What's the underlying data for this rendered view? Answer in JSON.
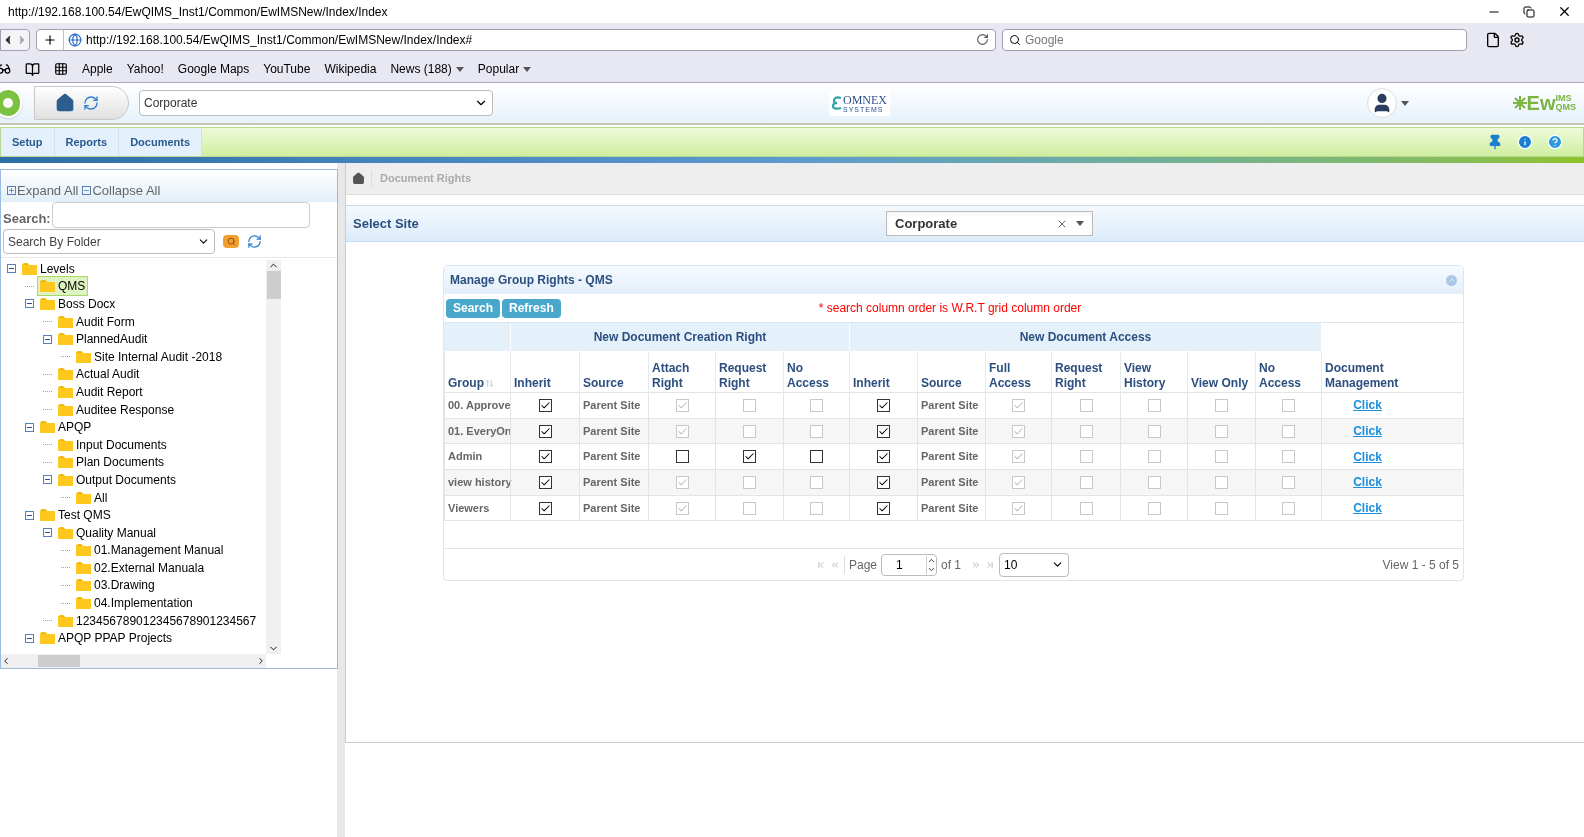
{
  "window": {
    "title": "http://192.168.100.54/EwQIMS_Inst1/Common/EwIMSNew/Index/Index"
  },
  "browser": {
    "address": "http://192.168.100.54/EwQIMS_Inst1/Common/EwIMSNew/Index/Index#",
    "search_placeholder": "Google",
    "bookmarks": [
      {
        "label": "Apple",
        "menu": false
      },
      {
        "label": "Yahoo!",
        "menu": false
      },
      {
        "label": "Google Maps",
        "menu": false
      },
      {
        "label": "YouTube",
        "menu": false
      },
      {
        "label": "Wikipedia",
        "menu": false
      },
      {
        "label": "News (188)",
        "menu": true
      },
      {
        "label": "Popular",
        "menu": true
      }
    ]
  },
  "header": {
    "site_select": "Corporate",
    "logo_text": "OMNEX",
    "logo_subtext": "SYSTEMS",
    "brand": "Ew",
    "brand_sup": "IMS",
    "brand_sub": "QMS"
  },
  "nav_tabs": [
    {
      "label": "Setup",
      "selected": false
    },
    {
      "label": "Reports",
      "selected": false
    },
    {
      "label": "Documents",
      "selected": false
    }
  ],
  "sidebar": {
    "expand_all": "Expand All",
    "collapse_all": "Collapse All",
    "search_label": "Search:",
    "search_by": "Search By Folder",
    "tree": [
      {
        "label": "Levels",
        "expanded": true,
        "selected": false,
        "children": [
          {
            "label": "QMS",
            "selected": true
          },
          {
            "label": "Boss Docx",
            "expanded": true,
            "selected": false,
            "children": [
              {
                "label": "Audit Form",
                "selected": false
              },
              {
                "label": "PlannedAudit",
                "expanded": true,
                "selected": false,
                "children": [
                  {
                    "label": "Site Internal Audit -2018",
                    "selected": false
                  }
                ]
              },
              {
                "label": "Actual Audit",
                "selected": false
              },
              {
                "label": "Audit Report",
                "selected": false
              },
              {
                "label": "Auditee Response",
                "selected": false
              }
            ]
          },
          {
            "label": "APQP",
            "expanded": true,
            "selected": false,
            "children": [
              {
                "label": "Input Documents",
                "selected": false
              },
              {
                "label": "Plan Documents",
                "selected": false
              },
              {
                "label": "Output Documents",
                "expanded": true,
                "selected": false,
                "children": [
                  {
                    "label": "All",
                    "selected": false
                  }
                ]
              }
            ]
          },
          {
            "label": "Test QMS",
            "expanded": true,
            "selected": false,
            "children": [
              {
                "label": "Quality Manual",
                "expanded": true,
                "selected": false,
                "children": [
                  {
                    "label": "01.Management Manual",
                    "selected": false
                  },
                  {
                    "label": "02.External Manuala",
                    "selected": false
                  },
                  {
                    "label": "03.Drawing",
                    "selected": false
                  },
                  {
                    "label": "04.Implementation",
                    "selected": false
                  }
                ]
              },
              {
                "label": "123456789012345678901234567",
                "selected": false
              }
            ]
          },
          {
            "label": "APQP PPAP Projects",
            "expanded": true,
            "selected": false
          }
        ]
      }
    ]
  },
  "breadcrumb": [
    "Document Rights"
  ],
  "site": {
    "label": "Select Site",
    "value": "Corporate"
  },
  "grid": {
    "title": "Manage Group Rights - QMS",
    "buttons": [
      "Search",
      "Refresh"
    ],
    "note": "* search column order is W.R.T grid column order",
    "groups": [
      {
        "label": "New Document Creation Right"
      },
      {
        "label": "New Document Access"
      }
    ],
    "columns": [
      "Group",
      "Inherit",
      "Source",
      "Attach Right",
      "Request Right",
      "No Access",
      "Inherit",
      "Source",
      "Full Access",
      "Request Right",
      "View History",
      "View Only",
      "No Access",
      "Document Management"
    ],
    "rows": [
      {
        "cells": [
          {
            "kind": "text",
            "text": "00. Approve"
          },
          {
            "kind": "check",
            "checked": true,
            "disabled": false
          },
          {
            "kind": "text",
            "text": "Parent Site"
          },
          {
            "kind": "check",
            "checked": true,
            "disabled": true
          },
          {
            "kind": "check",
            "checked": false,
            "disabled": true
          },
          {
            "kind": "check",
            "checked": false,
            "disabled": true
          },
          {
            "kind": "check",
            "checked": true,
            "disabled": false
          },
          {
            "kind": "text",
            "text": "Parent Site"
          },
          {
            "kind": "check",
            "checked": true,
            "disabled": true
          },
          {
            "kind": "check",
            "checked": false,
            "disabled": true
          },
          {
            "kind": "check",
            "checked": false,
            "disabled": true
          },
          {
            "kind": "check",
            "checked": false,
            "disabled": true
          },
          {
            "kind": "check",
            "checked": false,
            "disabled": true
          },
          {
            "kind": "link",
            "text": "Click"
          }
        ]
      },
      {
        "cells": [
          {
            "kind": "text",
            "text": "01. EveryOn"
          },
          {
            "kind": "check",
            "checked": true,
            "disabled": false
          },
          {
            "kind": "text",
            "text": "Parent Site"
          },
          {
            "kind": "check",
            "checked": true,
            "disabled": true
          },
          {
            "kind": "check",
            "checked": false,
            "disabled": true
          },
          {
            "kind": "check",
            "checked": false,
            "disabled": true
          },
          {
            "kind": "check",
            "checked": true,
            "disabled": false
          },
          {
            "kind": "text",
            "text": "Parent Site"
          },
          {
            "kind": "check",
            "checked": true,
            "disabled": true
          },
          {
            "kind": "check",
            "checked": false,
            "disabled": true
          },
          {
            "kind": "check",
            "checked": false,
            "disabled": true
          },
          {
            "kind": "check",
            "checked": false,
            "disabled": true
          },
          {
            "kind": "check",
            "checked": false,
            "disabled": true
          },
          {
            "kind": "link",
            "text": "Click"
          }
        ]
      },
      {
        "cells": [
          {
            "kind": "text",
            "text": "Admin"
          },
          {
            "kind": "check",
            "checked": true,
            "disabled": false
          },
          {
            "kind": "text",
            "text": "Parent Site"
          },
          {
            "kind": "check",
            "checked": false,
            "disabled": false
          },
          {
            "kind": "check",
            "checked": true,
            "disabled": false
          },
          {
            "kind": "check",
            "checked": false,
            "disabled": false
          },
          {
            "kind": "check",
            "checked": true,
            "disabled": false
          },
          {
            "kind": "text",
            "text": "Parent Site"
          },
          {
            "kind": "check",
            "checked": true,
            "disabled": true
          },
          {
            "kind": "check",
            "checked": false,
            "disabled": true
          },
          {
            "kind": "check",
            "checked": false,
            "disabled": true
          },
          {
            "kind": "check",
            "checked": false,
            "disabled": true
          },
          {
            "kind": "check",
            "checked": false,
            "disabled": true
          },
          {
            "kind": "link",
            "text": "Click"
          }
        ]
      },
      {
        "cells": [
          {
            "kind": "text",
            "text": "view history"
          },
          {
            "kind": "check",
            "checked": true,
            "disabled": false
          },
          {
            "kind": "text",
            "text": "Parent Site"
          },
          {
            "kind": "check",
            "checked": true,
            "disabled": true
          },
          {
            "kind": "check",
            "checked": false,
            "disabled": true
          },
          {
            "kind": "check",
            "checked": false,
            "disabled": true
          },
          {
            "kind": "check",
            "checked": true,
            "disabled": false
          },
          {
            "kind": "text",
            "text": "Parent Site"
          },
          {
            "kind": "check",
            "checked": true,
            "disabled": true
          },
          {
            "kind": "check",
            "checked": false,
            "disabled": true
          },
          {
            "kind": "check",
            "checked": false,
            "disabled": true
          },
          {
            "kind": "check",
            "checked": false,
            "disabled": true
          },
          {
            "kind": "check",
            "checked": false,
            "disabled": true
          },
          {
            "kind": "link",
            "text": "Click"
          }
        ]
      },
      {
        "cells": [
          {
            "kind": "text",
            "text": "Viewers"
          },
          {
            "kind": "check",
            "checked": true,
            "disabled": false
          },
          {
            "kind": "text",
            "text": "Parent Site"
          },
          {
            "kind": "check",
            "checked": true,
            "disabled": true
          },
          {
            "kind": "check",
            "checked": false,
            "disabled": true
          },
          {
            "kind": "check",
            "checked": false,
            "disabled": true
          },
          {
            "kind": "check",
            "checked": true,
            "disabled": false
          },
          {
            "kind": "text",
            "text": "Parent Site"
          },
          {
            "kind": "check",
            "checked": true,
            "disabled": true
          },
          {
            "kind": "check",
            "checked": false,
            "disabled": true
          },
          {
            "kind": "check",
            "checked": false,
            "disabled": true
          },
          {
            "kind": "check",
            "checked": false,
            "disabled": true
          },
          {
            "kind": "check",
            "checked": false,
            "disabled": true
          },
          {
            "kind": "link",
            "text": "Click"
          }
        ]
      }
    ],
    "pager": {
      "page_label": "Page",
      "page": "1",
      "of": "of 1",
      "page_size": "10",
      "summary": "View 1 - 5 of 5"
    }
  }
}
